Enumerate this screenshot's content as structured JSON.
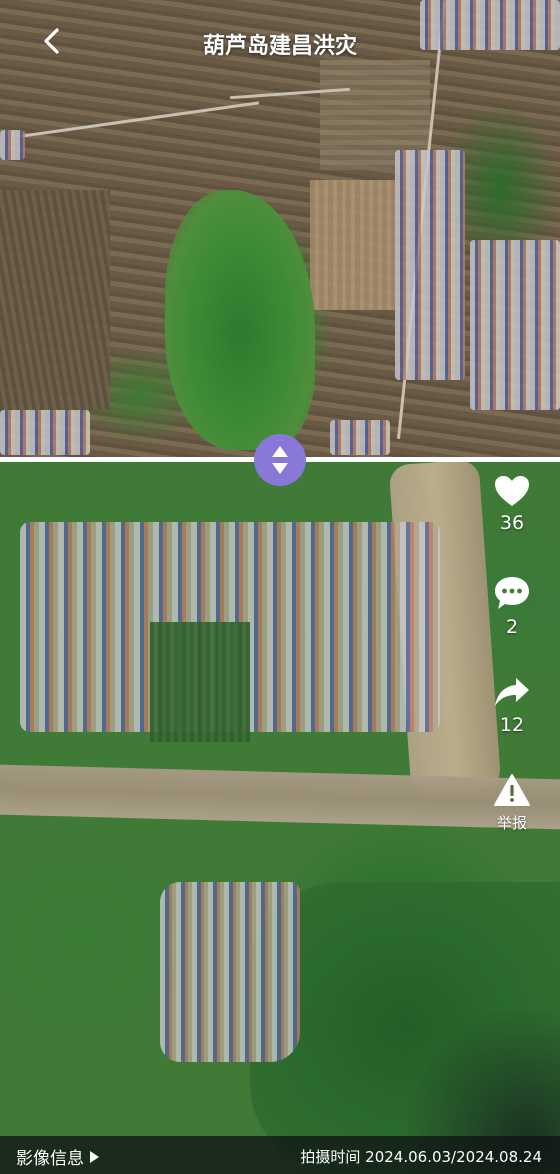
{
  "header": {
    "title": "葫芦岛建昌洪灾",
    "back_icon": "chevron-left-icon"
  },
  "images": {
    "top_label": "satellite-before",
    "bottom_label": "satellite-after"
  },
  "divider": {
    "handle_icon": "up-down-arrows-icon",
    "handle_color": "#8a78d8"
  },
  "actions": {
    "like": {
      "icon": "heart-icon",
      "count": "36"
    },
    "comment": {
      "icon": "comment-bubble-icon",
      "count": "2"
    },
    "share": {
      "icon": "share-arrow-icon",
      "count": "12"
    },
    "report": {
      "icon": "warning-triangle-icon",
      "label": "举报"
    }
  },
  "bottom_bar": {
    "info_label": "影像信息",
    "capture_time_label": "拍摄时间",
    "capture_time_value": "2024.06.03/2024.08.24"
  }
}
